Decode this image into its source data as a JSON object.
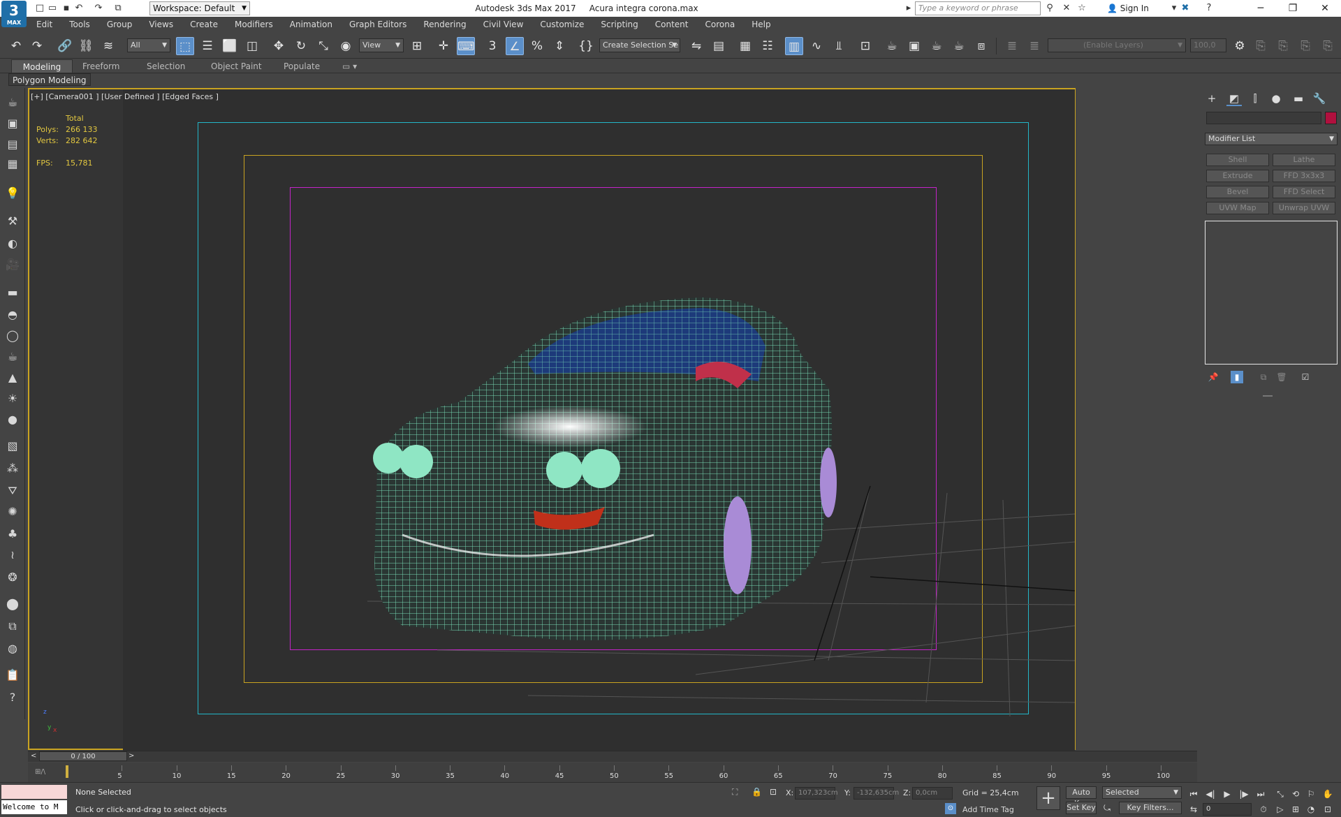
{
  "window": {
    "app_name": "Autodesk 3ds Max 2017",
    "file_name": "Acura integra corona.max",
    "title": "Autodesk 3ds Max 2017     Acura integra corona.max",
    "logo": "3",
    "logo_sub": "MAX",
    "workspace": "Workspace: Default",
    "search_placeholder": "Type a keyword or phrase",
    "sign_in": "Sign In"
  },
  "menu": [
    "Edit",
    "Tools",
    "Group",
    "Views",
    "Create",
    "Modifiers",
    "Animation",
    "Graph Editors",
    "Rendering",
    "Civil View",
    "Customize",
    "Scripting",
    "Content",
    "Corona",
    "Help"
  ],
  "toolbar": {
    "selection_filter": "All",
    "ref_coord": "View",
    "named_selection": "Create Selection Se",
    "layer_field": "(Enable Layers)",
    "layer_value": "100,0"
  },
  "ribbon": {
    "tabs": [
      "Modeling",
      "Freeform",
      "Selection",
      "Object Paint",
      "Populate"
    ],
    "sub": "Polygon Modeling"
  },
  "viewport": {
    "label": "[+] [Camera001 ] [User Defined ] [Edged Faces ]",
    "stats": {
      "total_label": "Total",
      "polys_label": "Polys:",
      "polys": "266 133",
      "verts_label": "Verts:",
      "verts": "282 642",
      "fps_label": "FPS:",
      "fps": "15,781"
    }
  },
  "command_panel": {
    "modifier_list": "Modifier List",
    "buttons": [
      "Shell",
      "Lathe",
      "Extrude",
      "FFD 3x3x3",
      "Bevel",
      "FFD Select",
      "UVW Map",
      "Unwrap UVW"
    ]
  },
  "timeline": {
    "position": "0 / 100",
    "ticks": [
      "5",
      "10",
      "15",
      "20",
      "25",
      "30",
      "35",
      "40",
      "45",
      "50",
      "55",
      "60",
      "65",
      "70",
      "75",
      "80",
      "85",
      "90",
      "95",
      "100"
    ]
  },
  "status": {
    "listener": "Welcome to M",
    "selection": "None Selected",
    "prompt": "Click or click-and-drag to select objects",
    "x_label": "X:",
    "x": "107,323cm",
    "y_label": "Y:",
    "y": "-132,635cm",
    "z_label": "Z:",
    "z": "0,0cm",
    "grid": "Grid = 25,4cm",
    "add_time_tag": "Add Time Tag",
    "auto_key": "Auto Key",
    "set_key": "Set Key",
    "key_mode": "Selected",
    "key_filters": "Key Filters...",
    "frame": "0"
  },
  "colors": {
    "accent": "#5b8fc9",
    "wire": "#7fe8c0",
    "viewport_border": "#c9a321"
  }
}
